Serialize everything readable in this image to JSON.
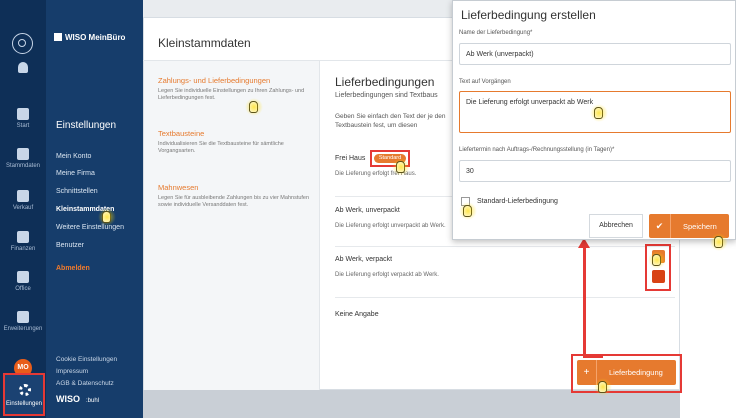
{
  "rail": {
    "items": [
      {
        "label": "Start"
      },
      {
        "label": "Stammdaten"
      },
      {
        "label": "Verkauf"
      },
      {
        "label": "Finanzen"
      },
      {
        "label": "Office"
      },
      {
        "label": "Erweiterungen"
      }
    ],
    "avatar": "MO",
    "settings": "Einstellungen"
  },
  "nav2": {
    "brand": "WISO MeinBüro",
    "heading": "Einstellungen",
    "items": [
      "Mein Konto",
      "Meine Firma",
      "Schnittstellen",
      "Kleinstammdaten",
      "Weitere Einstellungen",
      "Benutzer",
      "Abmelden"
    ],
    "footer": [
      "Cookie Einstellungen",
      "Impressum",
      "AGB & Datenschutz"
    ],
    "logo": "WISO",
    "logo2": ":buhl"
  },
  "main": {
    "title": "Kleinstammdaten",
    "sections": [
      {
        "title": "Zahlungs- und Lieferbedingungen",
        "desc": "Legen Sie individuelle Einstellungen zu Ihren Zahlungs- und Lieferbedingungen fest."
      },
      {
        "title": "Textbausteine",
        "desc": "Individualisieren Sie die Textbausteine für sämtliche Vorgangsarten."
      },
      {
        "title": "Mahnwesen",
        "desc": "Legen Sie für ausbleibende Zahlungen bis zu vier Mahnstufen sowie individuelle Versanddaten fest."
      }
    ],
    "panel_title": "Lieferbedingungen",
    "panel_sub": "Lieferbedingungen sind Textbaus",
    "intro": "Geben Sie einfach den Text der je den Textbaustein fest, um diesen",
    "rows": [
      {
        "name": "Frei Haus",
        "text": "Die Lieferung erfolgt frei Haus."
      },
      {
        "name": "Ab Werk, unverpackt",
        "text": "Die Lieferung erfolgt unverpackt ab Werk."
      },
      {
        "name": "Ab Werk, verpackt",
        "text": "Die Lieferung erfolgt verpackt ab Werk."
      },
      {
        "name": "Keine Angabe",
        "text": ""
      }
    ],
    "standard_badge": "Standard",
    "add_button": "Lieferbedingung",
    "add_icon": "+"
  },
  "modal": {
    "title": "Lieferbedingung erstellen",
    "name_label": "Name der Lieferbedingung*",
    "name_value": "Ab Werk (unverpackt)",
    "text_label": "Text auf Vorgängen",
    "text_value": "Die Lieferung erfolgt unverpackt ab Werk",
    "term_label": "Liefertermin nach Auftrags-/Rechnungsstellung (in Tagen)*",
    "term_value": "30",
    "checkbox_label": "Standard-Lieferbedingung",
    "cancel": "Abbrechen",
    "save": "Speichern",
    "save_icon": "✔"
  },
  "colors": {
    "accent": "#e67a2e",
    "highlight": "#e53935",
    "nav": "#163d6b",
    "rail": "#0e2f57"
  }
}
